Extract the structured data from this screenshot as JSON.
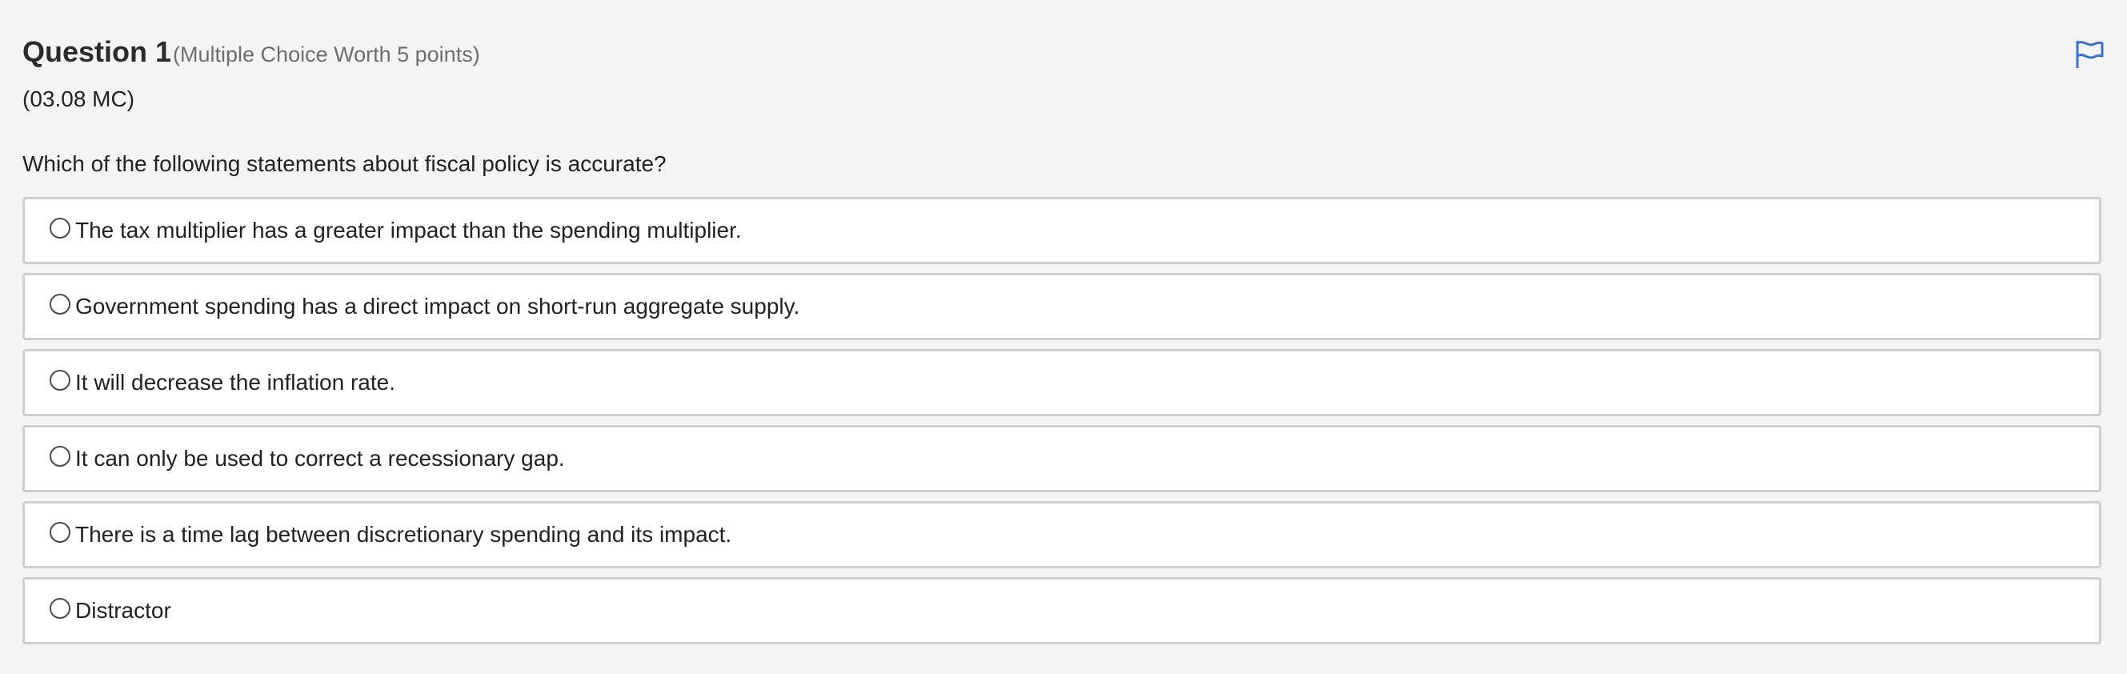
{
  "question": {
    "title": "Question 1",
    "meta": "(Multiple Choice Worth 5 points)",
    "code": "(03.08 MC)",
    "prompt": "Which of the following statements about fiscal policy is accurate?",
    "flag_icon": "flag-icon",
    "accent_color": "#3d6fc9"
  },
  "options": [
    {
      "label": "The tax multiplier has a greater impact than the spending multiplier.",
      "selected": false
    },
    {
      "label": "Government spending has a direct impact on short-run aggregate supply.",
      "selected": false
    },
    {
      "label": "It will decrease the inflation rate.",
      "selected": false
    },
    {
      "label": "It can only be used to correct a recessionary gap.",
      "selected": false
    },
    {
      "label": "There is a time lag between discretionary spending and its impact.",
      "selected": false
    },
    {
      "label": "Distractor",
      "selected": false
    }
  ]
}
